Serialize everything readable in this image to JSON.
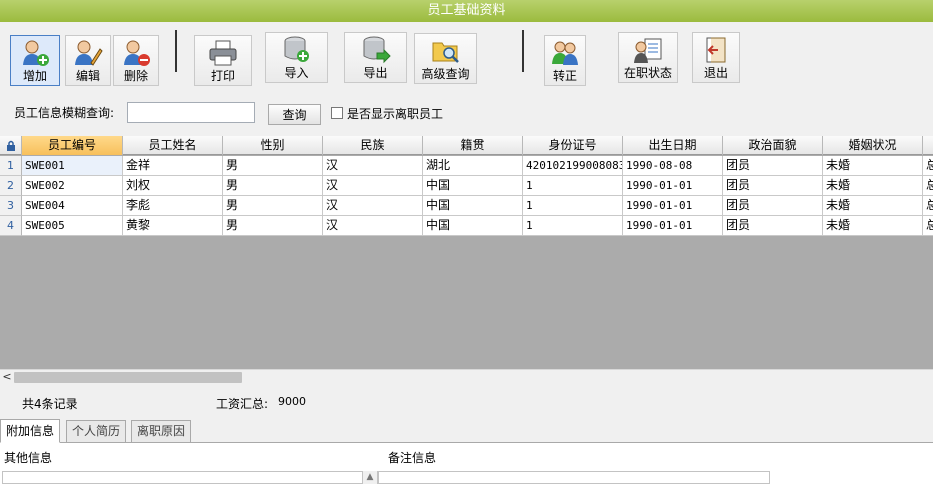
{
  "window": {
    "title": "员工基础资料"
  },
  "toolbar": {
    "add": "增加",
    "edit": "编辑",
    "delete": "删除",
    "print": "打印",
    "import": "导入",
    "export": "导出",
    "advanced_query": "高级查询",
    "regularize": "转正",
    "employment_status": "在职状态",
    "exit": "退出"
  },
  "search": {
    "label": "员工信息模糊查询:",
    "value": "",
    "button": "查询",
    "show_resigned_label": "是否显示离职员工",
    "show_resigned_checked": false
  },
  "grid": {
    "columns": [
      "员工编号",
      "员工姓名",
      "性别",
      "民族",
      "籍贯",
      "身份证号",
      "出生日期",
      "政治面貌",
      "婚姻状况",
      "总"
    ],
    "rows": [
      {
        "num": "1",
        "cells": [
          "SWE001",
          "金祥",
          "男",
          "汉",
          "湖北",
          "420102199008083",
          "1990-08-08",
          "团员",
          "未婚",
          "总"
        ]
      },
      {
        "num": "2",
        "cells": [
          "SWE002",
          "刘权",
          "男",
          "汉",
          "中国",
          "1",
          "1990-01-01",
          "团员",
          "未婚",
          "总"
        ]
      },
      {
        "num": "3",
        "cells": [
          "SWE004",
          "李彪",
          "男",
          "汉",
          "中国",
          "1",
          "1990-01-01",
          "团员",
          "未婚",
          "总"
        ]
      },
      {
        "num": "4",
        "cells": [
          "SWE005",
          "黄黎",
          "男",
          "汉",
          "中国",
          "1",
          "1990-01-01",
          "团员",
          "未婚",
          "总"
        ]
      }
    ]
  },
  "summary": {
    "record_count": "共4条记录",
    "wage_total_label": "工资汇总:",
    "wage_total_value": "9000"
  },
  "tabs": [
    "附加信息",
    "个人简历",
    "离职原因"
  ],
  "panels": {
    "other_info_label": "其他信息",
    "remarks_label": "备注信息"
  },
  "colors": {
    "titlebar": "#a5c34c",
    "selected_header": "#f7c05c",
    "grid_background": "#ababab"
  }
}
